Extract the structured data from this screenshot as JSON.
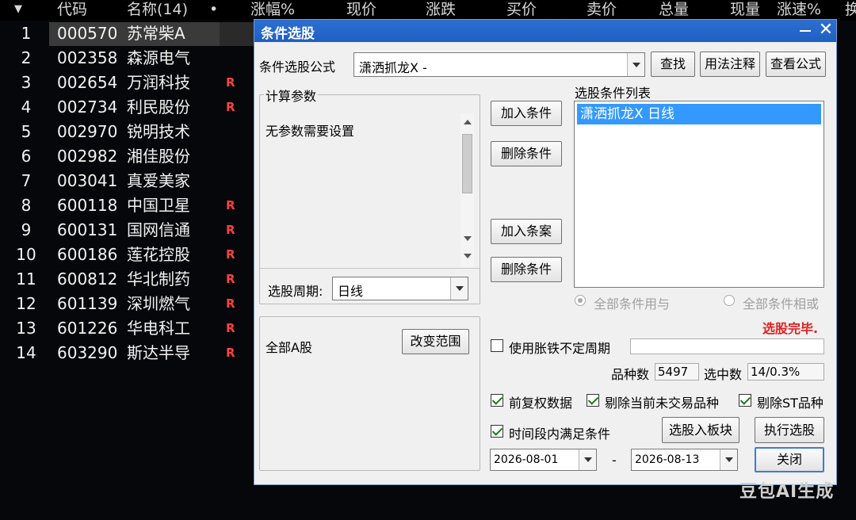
{
  "table": {
    "headers": {
      "sort_arrow": "▼",
      "code": "代码",
      "name": "名称(14)",
      "dot": "•",
      "change_pct": "涨幅%",
      "price": "现价",
      "change": "涨跌",
      "bid": "买价",
      "ask": "卖价",
      "volume": "总量",
      "current_vol": "现量",
      "speed": "涨速%",
      "extra": "换"
    },
    "rows": [
      {
        "idx": "1",
        "code": "000570",
        "name": "苏常柴A",
        "mark": ""
      },
      {
        "idx": "2",
        "code": "002358",
        "name": "森源电气",
        "mark": ""
      },
      {
        "idx": "3",
        "code": "002654",
        "name": "万润科技",
        "mark": "R"
      },
      {
        "idx": "4",
        "code": "002734",
        "name": "利民股份",
        "mark": "R"
      },
      {
        "idx": "5",
        "code": "002970",
        "name": "锐明技术",
        "mark": ""
      },
      {
        "idx": "6",
        "code": "002982",
        "name": "湘佳股份",
        "mark": ""
      },
      {
        "idx": "7",
        "code": "003041",
        "name": "真爱美家",
        "mark": ""
      },
      {
        "idx": "8",
        "code": "600118",
        "name": "中国卫星",
        "mark": "R"
      },
      {
        "idx": "9",
        "code": "600131",
        "name": "国网信通",
        "mark": "R"
      },
      {
        "idx": "10",
        "code": "600186",
        "name": "莲花控股",
        "mark": "R"
      },
      {
        "idx": "11",
        "code": "600812",
        "name": "华北制药",
        "mark": "R"
      },
      {
        "idx": "12",
        "code": "601139",
        "name": "深圳燃气",
        "mark": "R"
      },
      {
        "idx": "13",
        "code": "601226",
        "name": "华电科工",
        "mark": "R"
      },
      {
        "idx": "14",
        "code": "603290",
        "name": "斯达半导",
        "mark": "R"
      }
    ]
  },
  "dialog": {
    "title": "条件选股",
    "formula_label": "条件选股公式",
    "formula_value": "潇洒抓龙X -",
    "find_button": "查找",
    "usage_button": "用法注释",
    "view_formula_button": "查看公式",
    "params_group": "计算参数",
    "params_text": "无参数需要设置",
    "period_label": "选股周期:",
    "period_value": "日线",
    "add_condition_button": "加入条件",
    "delete_condition_button": "删除条件",
    "add_case_button": "加入条案",
    "delete_condition_button2": "删除条件",
    "condition_list_label": "选股条件列表",
    "condition_list_items": [
      "潇洒抓龙X 日线"
    ],
    "radio_and": "全部条件用与",
    "radio_or": "全部条件相或",
    "status_text": "选股完毕.",
    "scope_text": "全部A股",
    "change_scope_button": "改变范围",
    "use_adjust_period": "使用胀铁不定周期",
    "variety_count_label": "品种数",
    "variety_count_value": "5497",
    "selected_count_label": "选中数",
    "selected_count_value": "14/0.3%",
    "pre_adjust": "前复权数据",
    "exclude_untraded": "剔除当前未交易品种",
    "exclude_st": "剔除ST品种",
    "time_condition": "时间段内满足条件",
    "to_block_button": "选股入板块",
    "execute_button": "执行选股",
    "date_from": "2026-08-01",
    "date_sep": "-",
    "date_to": "2026-08-13",
    "close_button": "关闭"
  },
  "watermark": "豆包AI生成",
  "colors": {
    "background": "#05070a",
    "title_bar": "#1f5fc2",
    "selection": "#3399ff",
    "status_red": "#e02020",
    "mark_red": "#ff4040"
  }
}
